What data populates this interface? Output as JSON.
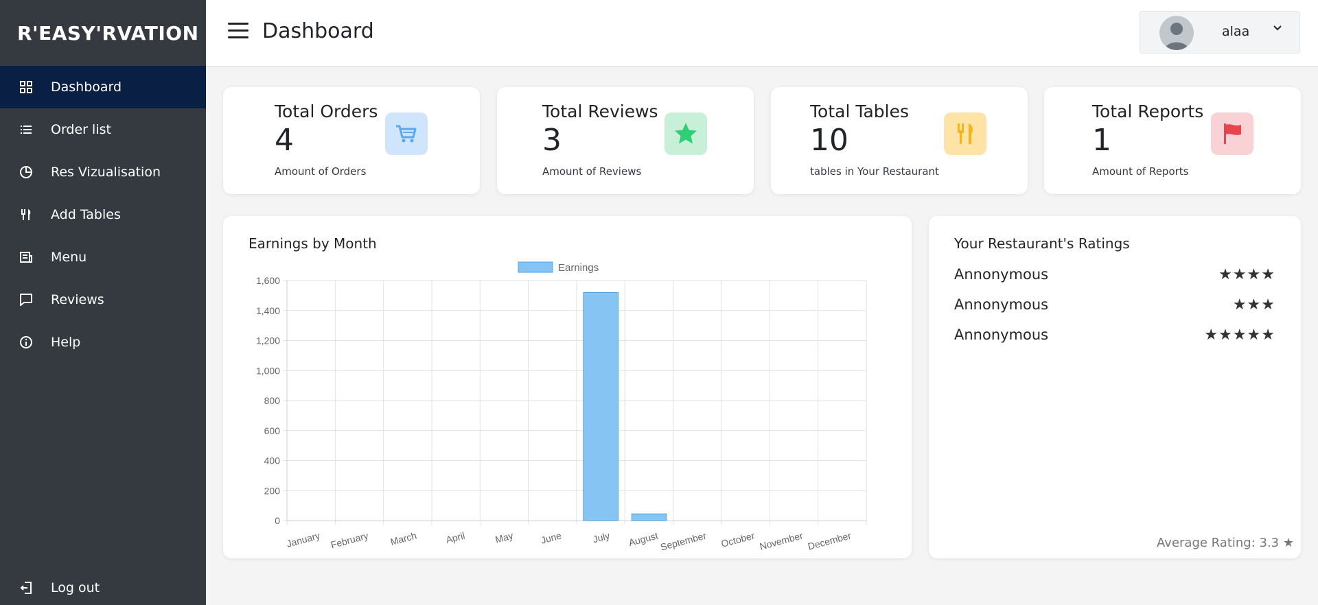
{
  "sidebar": {
    "brand": "R'EASY'RVATION",
    "items": [
      {
        "label": "Dashboard",
        "icon": "grid-icon",
        "active": true
      },
      {
        "label": "Order list",
        "icon": "list-icon"
      },
      {
        "label": "Res Vizualisation",
        "icon": "pie-chart-icon"
      },
      {
        "label": "Add Tables",
        "icon": "utensils-icon"
      },
      {
        "label": "Menu",
        "icon": "menu-doc-icon"
      },
      {
        "label": "Reviews",
        "icon": "chat-icon"
      },
      {
        "label": "Help",
        "icon": "info-icon"
      }
    ],
    "logout": "Log out"
  },
  "header": {
    "title": "Dashboard",
    "username": "alaa"
  },
  "stats": [
    {
      "title": "Total Orders",
      "value": "4",
      "sub": "Amount of Orders",
      "icon": "cart-icon",
      "icon_bg": "#cfe5fb",
      "icon_color": "#5aa9f0"
    },
    {
      "title": "Total Reviews",
      "value": "3",
      "sub": "Amount of Reviews",
      "icon": "star-icon",
      "icon_bg": "#c8f0d8",
      "icon_color": "#2fcf73"
    },
    {
      "title": "Total Tables",
      "value": "10",
      "sub": "tables in Your Restaurant",
      "icon": "utensils-icon",
      "icon_bg": "#fde3a6",
      "icon_color": "#f7b416"
    },
    {
      "title": "Total Reports",
      "value": "1",
      "sub": "Amount of Reports",
      "icon": "flag-icon",
      "icon_bg": "#f9d2d5",
      "icon_color": "#e8444f"
    }
  ],
  "chart_card": {
    "title": "Earnings by Month"
  },
  "chart_data": {
    "type": "bar",
    "categories": [
      "January",
      "February",
      "March",
      "April",
      "May",
      "June",
      "July",
      "August",
      "September",
      "October",
      "November",
      "December"
    ],
    "series": [
      {
        "name": "Earnings",
        "values": [
          0,
          0,
          0,
          0,
          0,
          0,
          1520,
          45,
          0,
          0,
          0,
          0
        ]
      }
    ],
    "ylim": [
      0,
      1600
    ],
    "yticks": [
      "0",
      "200",
      "400",
      "600",
      "800",
      "1,000",
      "1,200",
      "1,400",
      "1,600"
    ],
    "grid": true,
    "legend": "top-center",
    "bar_color": "#85c4f3",
    "bar_border": "#4ea3e6"
  },
  "ratings": {
    "title": "Your Restaurant's Ratings",
    "items": [
      {
        "name": "Annonymous",
        "stars": "★★★★"
      },
      {
        "name": "Annonymous",
        "stars": "★★★"
      },
      {
        "name": "Annonymous",
        "stars": "★★★★★"
      }
    ],
    "average": "Average Rating: 3.3 ★"
  }
}
